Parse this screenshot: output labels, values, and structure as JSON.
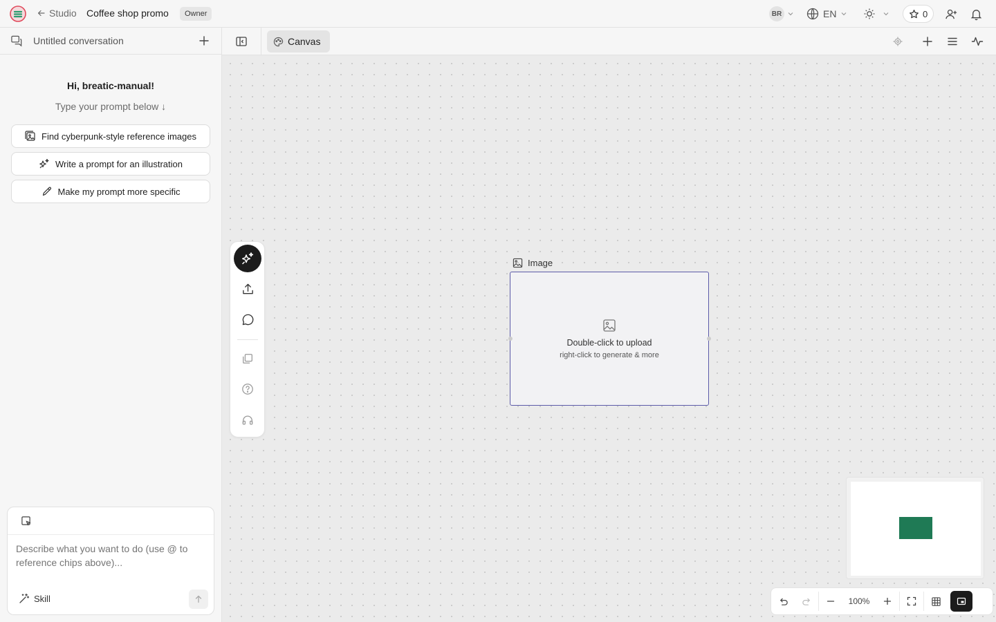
{
  "topbar": {
    "back_label": "Studio",
    "project_title": "Coffee shop promo",
    "role_badge": "Owner",
    "user_initials": "BR",
    "language": "EN",
    "star_count": "0"
  },
  "sidebar": {
    "conversation_title": "Untitled conversation",
    "greeting": "Hi, breatic-manual!",
    "prompt_hint": "Type your prompt below ↓",
    "suggestions": [
      {
        "label": "Find cyberpunk-style reference images",
        "icon": "image-search-icon"
      },
      {
        "label": "Write a prompt for an illustration",
        "icon": "sparkles-icon"
      },
      {
        "label": "Make my prompt more specific",
        "icon": "pencil-icon"
      }
    ],
    "composer": {
      "placeholder": "Describe what you want to do (use @ to reference chips above)...",
      "skill_label": "Skill"
    }
  },
  "canvas_bar": {
    "tab_label": "Canvas"
  },
  "canvas": {
    "image_node": {
      "label": "Image",
      "upload_text": "Double-click to upload",
      "generate_text": "right-click to generate & more"
    },
    "zoom_level": "100%"
  },
  "colors": {
    "node_border": "#5b5aa8",
    "minimap_node": "#1f7a55",
    "rail_active": "#1c1c1c"
  }
}
